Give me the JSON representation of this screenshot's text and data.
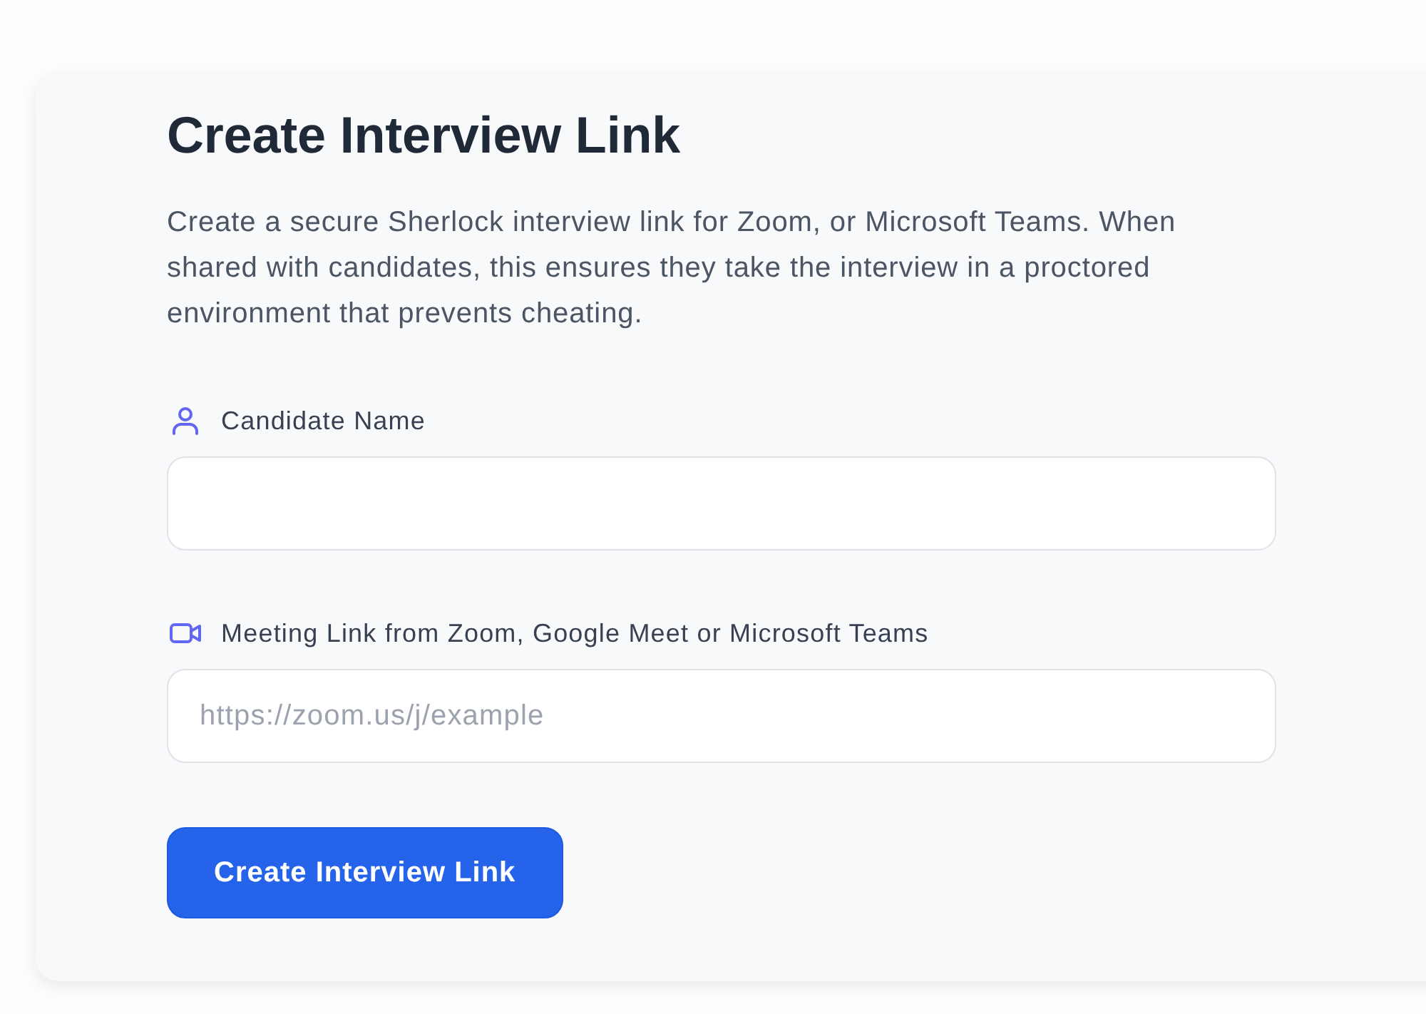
{
  "form": {
    "title": "Create Interview Link",
    "description": "Create a secure Sherlock interview link for Zoom, or Microsoft Teams. When shared with candidates, this ensures they take the interview in a proctored environment that prevents cheating.",
    "fields": [
      {
        "kind": "name",
        "label": "Candidate Name"
      },
      {
        "kind": "meeting",
        "label": "Meeting Link from Zoom, Google Meet or Microsoft Teams",
        "placeholder": "https://zoom.us/j/example"
      }
    ],
    "submit_button": {
      "label": "Create Interview Link"
    }
  }
}
